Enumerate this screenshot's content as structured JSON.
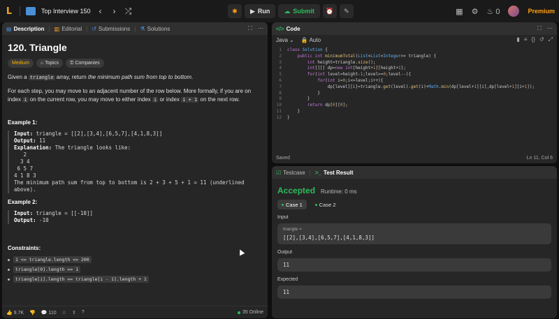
{
  "topbar": {
    "list_title": "Top Interview 150",
    "run_label": "Run",
    "submit_label": "Submit",
    "streak": "0",
    "premium_label": "Premium"
  },
  "left_tabs": [
    {
      "label": "Description",
      "icon": "doc-icon"
    },
    {
      "label": "Editorial",
      "icon": "book-icon"
    },
    {
      "label": "Submissions",
      "icon": "history-icon"
    },
    {
      "label": "Solutions",
      "icon": "flask-icon"
    }
  ],
  "problem": {
    "title": "120. Triangle",
    "difficulty": "Medium",
    "topics_label": "Topics",
    "companies_label": "Companies",
    "p1_a": "Given a",
    "p1_code": "triangle",
    "p1_b": "array, return",
    "p1_c": "the minimum path sum from top to bottom",
    "p1_d": ".",
    "p2_a": "For each step, you may move to an adjacent number of the row below. More formally, if you are on index",
    "p2_i": "i",
    "p2_b": "on the current row, you may move to either index",
    "p2_i2": "i",
    "p2_c": "or index",
    "p2_i3": "i + 1",
    "p2_d": "on the next row.",
    "ex1_title": "Example 1:",
    "ex1_input_label": "Input:",
    "ex1_input": "triangle = [[2],[3,4],[6,5,7],[4,1,8,3]]",
    "ex1_output_label": "Output:",
    "ex1_output": "11",
    "ex1_expl_label": "Explanation:",
    "ex1_expl": "The triangle looks like:",
    "ex1_tri": "   2\n  3 4\n 6 5 7\n4 1 8 3",
    "ex1_tail": "The minimum path sum from top to bottom is 2 + 3 + 5 + 1 = 11 (underlined\nabove).",
    "ex2_title": "Example 2:",
    "ex2_input_label": "Input:",
    "ex2_input": "triangle = [[-10]]",
    "ex2_output_label": "Output:",
    "ex2_output": "-10",
    "constraints_title": "Constraints:",
    "constraints": [
      "1 <= triangle.length <= 200",
      "triangle[0].length == 1",
      "triangle[i].length == triangle[i - 1].length + 1"
    ]
  },
  "footer": {
    "likes": "9.7K",
    "comments": "110",
    "online": "35 Online"
  },
  "code_panel": {
    "title": "Code",
    "language": "Java",
    "auto_label": "Auto",
    "saved_label": "Saved",
    "cursor_pos": "Ln 11, Col 6",
    "lines": [
      "class Solution {",
      "    public int minimumTotal(List<List<Integer>> triangle) {",
      "        int height=triangle.size();",
      "        int[][] dp=new int[height+1][height+1];",
      "        for(int level=height-1;level>=0;level--){",
      "            for(int i=0;i<=level;i++){",
      "                dp[level][i]=triangle.get(level).get(i)+Math.min(dp[level+1][i],dp[level+1][i+1]);",
      "            }",
      "        }",
      "        return dp[0][0];",
      "    }",
      "}"
    ]
  },
  "test_panel": {
    "tab_testcase": "Testcase",
    "tab_result": "Test Result",
    "status": "Accepted",
    "runtime": "Runtime: 0 ms",
    "case1": "Case 1",
    "case2": "Case 2",
    "input_label": "Input",
    "input_var": "triangle =",
    "input_value": "[[2],[3,4],[6,5,7],[4,1,8,3]]",
    "output_label": "Output",
    "output_value": "11",
    "expected_label": "Expected",
    "expected_value": "11",
    "status_color": "#2cbb5d"
  }
}
